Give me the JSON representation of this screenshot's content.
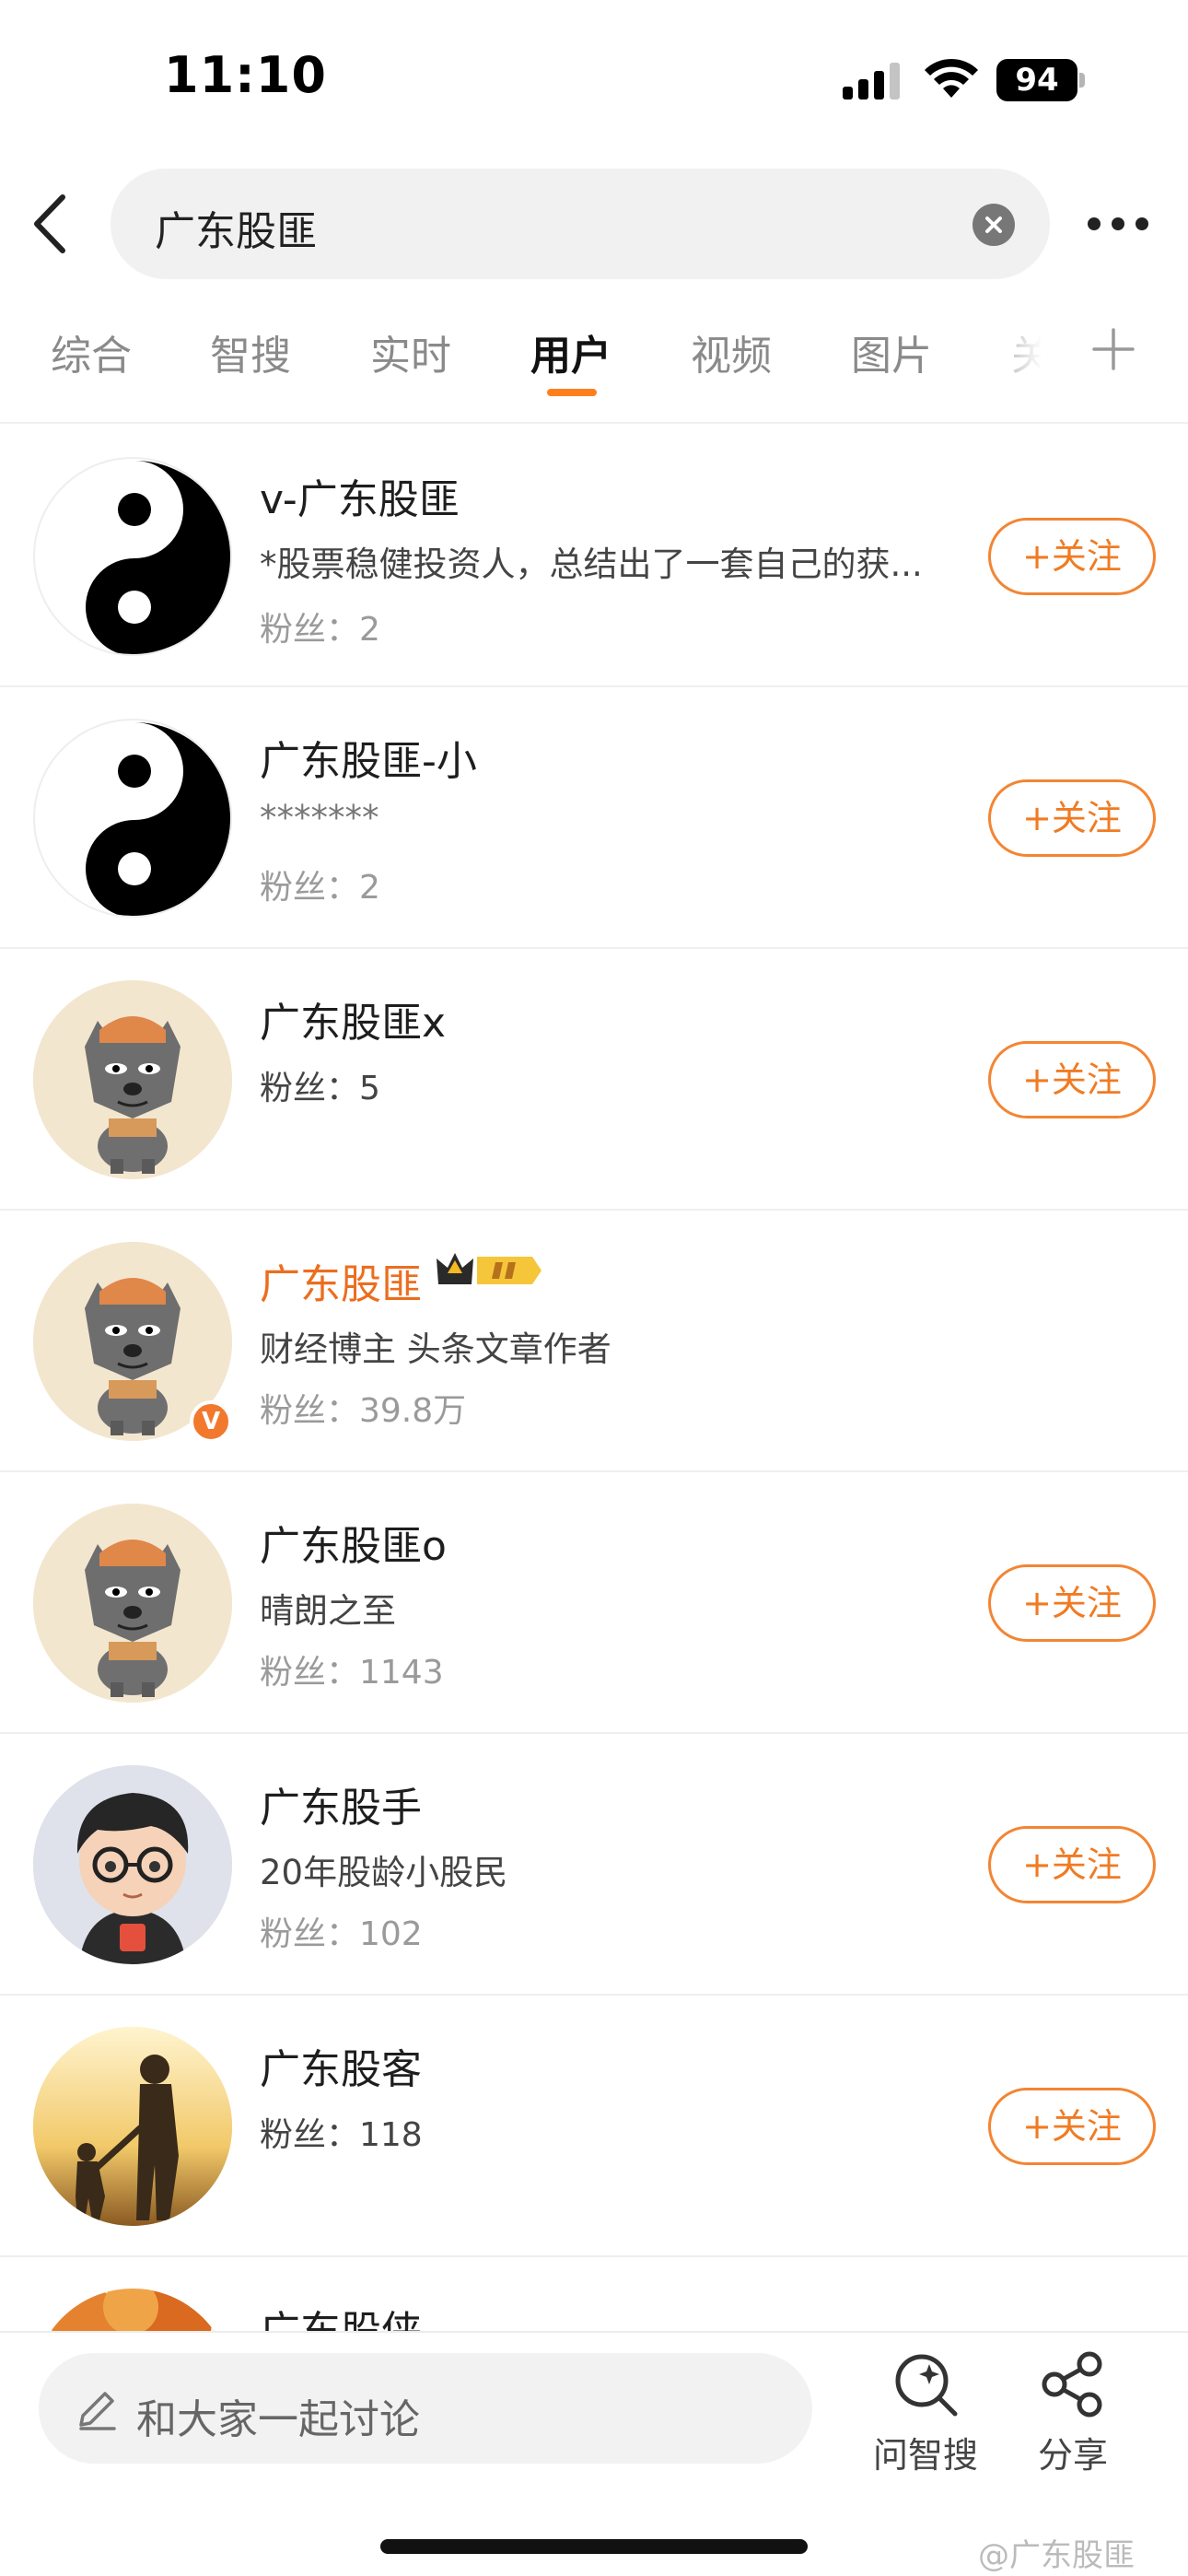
{
  "status_bar": {
    "time": "11:10",
    "battery": "94"
  },
  "search": {
    "query": "广东股匪"
  },
  "tabs": [
    {
      "label": "综合"
    },
    {
      "label": "智搜"
    },
    {
      "label": "实时"
    },
    {
      "label": "用户"
    },
    {
      "label": "视频"
    },
    {
      "label": "图片"
    },
    {
      "label": "关"
    }
  ],
  "active_tab": "用户",
  "users": [
    {
      "name": "v-广东股匪",
      "desc": "*股票稳健投资人，总结出了一套自己的获...",
      "fans": "粉丝：2",
      "follow": "+关注"
    },
    {
      "name": "广东股匪-小",
      "desc": "*******",
      "fans": "粉丝：2",
      "follow": "+关注"
    },
    {
      "name": "广东股匪x",
      "fans": "粉丝：5",
      "follow": "+关注"
    },
    {
      "name": "广东股匪",
      "desc": "财经博主 头条文章作者",
      "fans": "粉丝：39.8万",
      "badge": "V"
    },
    {
      "name": "广东股匪o",
      "desc": "晴朗之至",
      "fans": "粉丝：1143",
      "follow": "+关注"
    },
    {
      "name": "广东股手",
      "desc": "20年股龄小股民",
      "fans": "粉丝：102",
      "follow": "+关注"
    },
    {
      "name": "广东股客",
      "fans": "粉丝：118",
      "follow": "+关注"
    },
    {
      "name": "广东股侠"
    }
  ],
  "bottom": {
    "comment_placeholder": "和大家一起讨论",
    "ask_label": "问智搜",
    "share_label": "分享",
    "watermark": "@广东股匪"
  },
  "colors": {
    "accent": "#f07b23",
    "vip_name": "#ec6d1f",
    "verified": "#f2782e"
  }
}
